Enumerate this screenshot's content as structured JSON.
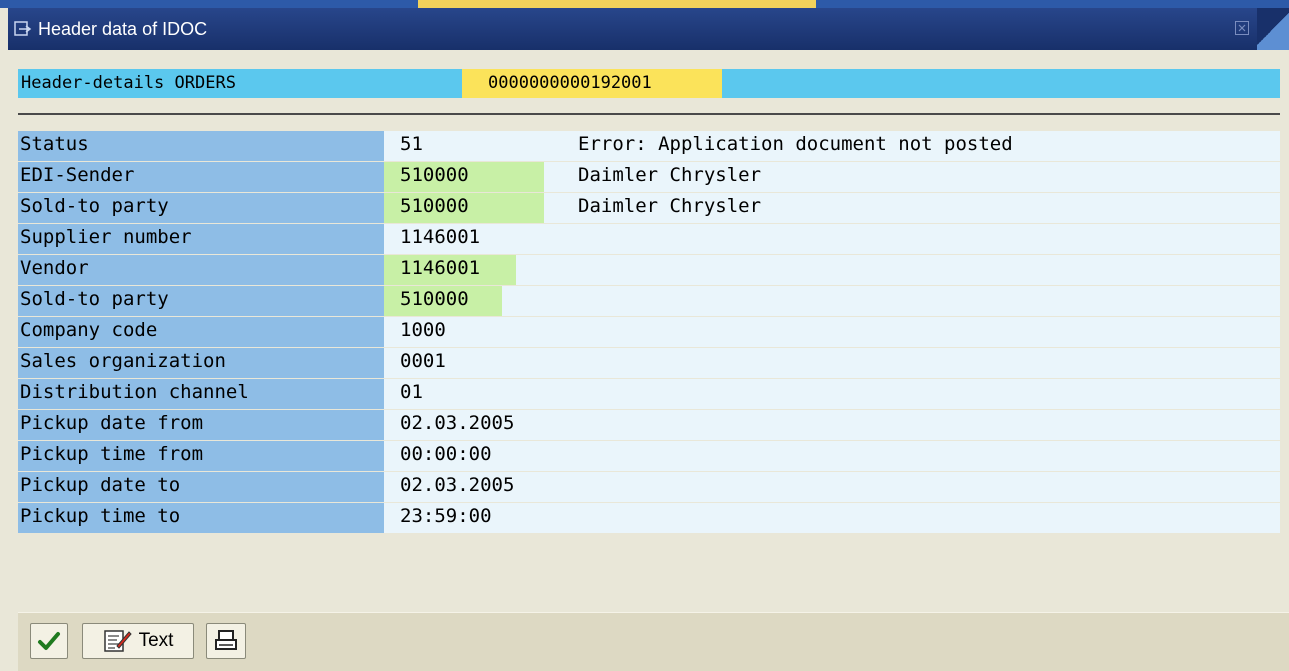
{
  "window": {
    "title": "Header data of IDOC"
  },
  "header": {
    "label": "Header-details ORDERS",
    "idoc_number": "0000000000192001"
  },
  "rows": [
    {
      "label": "Status",
      "value": "51",
      "desc": "Error: Application document not posted",
      "highlight": false
    },
    {
      "label": "EDI-Sender",
      "value": "510000",
      "desc": "Daimler Chrysler",
      "highlight": true
    },
    {
      "label": "Sold-to party",
      "value": "510000",
      "desc": "Daimler Chrysler",
      "highlight": true
    },
    {
      "label": "Supplier number",
      "value": "1146001",
      "desc": "",
      "highlight": false
    },
    {
      "label": "Vendor",
      "value": "1146001",
      "desc": "",
      "highlight": true
    },
    {
      "label": "Sold-to party",
      "value": "510000",
      "desc": "",
      "highlight": true
    },
    {
      "label": "Company code",
      "value": "1000",
      "desc": "",
      "highlight": false
    },
    {
      "label": "Sales organization",
      "value": "0001",
      "desc": "",
      "highlight": false
    },
    {
      "label": "Distribution channel",
      "value": "01",
      "desc": "",
      "highlight": false
    },
    {
      "label": "Pickup date from",
      "value": "02.03.2005",
      "desc": "",
      "highlight": false
    },
    {
      "label": "Pickup time from",
      "value": "00:00:00",
      "desc": "",
      "highlight": false
    },
    {
      "label": "Pickup date to",
      "value": "02.03.2005",
      "desc": "",
      "highlight": false
    },
    {
      "label": "Pickup time to",
      "value": "23:59:00",
      "desc": "",
      "highlight": false
    }
  ],
  "footer": {
    "text_button_label": "Text"
  },
  "icons": {
    "title": "window-icon",
    "close": "close-icon",
    "confirm": "checkmark-icon",
    "text": "edit-text-icon",
    "print": "print-icon"
  },
  "colors": {
    "title_bar": "#18306a",
    "header_bar": "#5bc8ee",
    "idoc_highlight": "#fbe35a",
    "label_cell": "#8ebde6",
    "value_area": "#eaf5fb",
    "value_highlight": "#c8f0a6",
    "footer": "#ddd9c3"
  }
}
